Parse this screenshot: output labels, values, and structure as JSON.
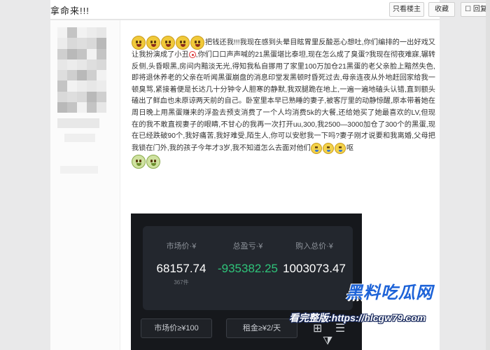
{
  "thread": {
    "title": "拿命来!!!",
    "only_op": "只看楼主",
    "favorite": "收藏",
    "reply": "回复"
  },
  "post": {
    "intro": "把钱还我!!!",
    "body_1": "我现在感到头晕目眩胃里反酸恶心想吐,你们编排的一出好戏又让我扮演成了小丑",
    "body_2": ",你们口口声声喊的21黑蛋堪比泰坦,现在怎么成了臭蛋?我现在彻夜难寐,辗转反侧,头昏眼黑,房间内黯淡无光,得知我私自挪用了家里100万加仓21黑蛋的老父亲脸上黯然失色,即将退休养老的父亲在听闻黑蛋崩盘的消息印堂发黑顿时昏死过去,母亲连夜从外地赶回家给我一顿臭骂,紧接着便是长达几十分钟令人胆寒的静默,我双腿跪在地上,一遍一遍地磕头认错,直到额头磕出了鲜血也未原谅两天前的自己。卧室里本早已熟睡的妻子,被客厅里的动静惊醒,原本带着她在周日晚上用黑蛋赚来的浮盈去预支消费了一个人均消费5k的大餐,还给她买了她最喜欢的LV,但现在的我不敢直视妻子的眼睛,不甘心的我再一次打开uu,300,我2500—3000加仓了300个的黑蛋,现在已经跌破90个,我好痛苦,我好难受,陌生人,你可以安慰我一下吗?妻子刚才说要和我离婚,父母把我锁在门外,我的孩子今年才3岁,我不知道怎么去面对他们",
    "tail": "呕"
  },
  "market": {
    "price_label": "市场价·¥",
    "price_value": "68157.74",
    "price_count": "367件",
    "pnl_label": "总盈亏·¥",
    "pnl_value": "-935382.25",
    "cost_label": "购入总价·¥",
    "cost_value": "1003073.47",
    "filter_price": "市场价≥¥100",
    "filter_rent": "租金≥¥2/天"
  },
  "watermark": {
    "brand": "黑料吃瓜网",
    "line": "看完整版:https://hlcgw79.com"
  },
  "colors": {
    "accent": "#1d63d8",
    "negative": "#2fc47a"
  }
}
